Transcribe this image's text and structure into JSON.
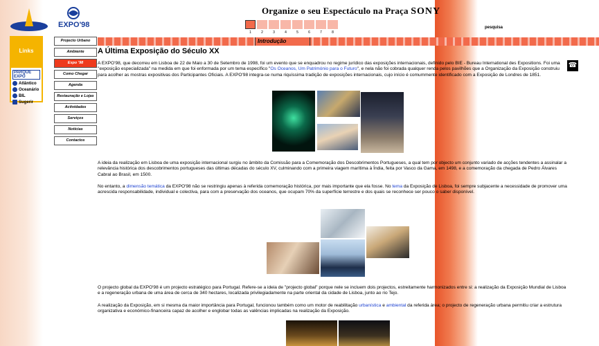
{
  "header": {
    "logo_expo_text": "EXPO'98",
    "title_prefix": "Organize o seu Espectáculo na Praça",
    "title_brand": "SONY",
    "pesquisa": "pesquisa"
  },
  "number_nav": [
    "1",
    "2",
    "3",
    "4",
    "5",
    "6",
    "7",
    "8"
  ],
  "left_panel": {
    "links_label": "Links",
    "parque_label": "PARQUE EXPO",
    "items": [
      "Atlântico",
      "Oceanário",
      "BIL",
      "Sugerir"
    ]
  },
  "menu": [
    "Projecto Urbano",
    "Ambiente",
    "Expo '98",
    "Como Chegar",
    "Agenda",
    "Restauração e Lojas",
    "Actividades",
    "Serviços",
    "Notícias",
    "Contactos"
  ],
  "section": {
    "bar_label": "Introdução",
    "title": "A Última Exposição do Século XX"
  },
  "content": {
    "p1_a": "A EXPO'98, que decorreu em Lisboa de 22 de Maio a 30 de Setembro de 1998, foi um evento que se enquadrou no regime jurídico das exposições internacionais, definido pelo BIE - Bureau International des Expositions. Foi uma \"exposição especializada\" na medida em que foi enformada por um tema específico \"",
    "p1_link": "Os Oceanos, Um Património para o Futuro",
    "p1_b": "\", e nela não foi cobrada qualquer renda pelos pavilhões que a Organização da Exposição construiu para acolher as mostras expositivas dos Participantes Oficiais. A EXPO'98 integra-se numa riquíssima tradição de exposições internacionais, cujo início é comummente identificado com a Exposição de Londres de 1851.",
    "p2": "A ideia da realização em Lisboa de uma exposição internacional surgiu no âmbito da Comissão para a Comemoração dos Descobrimentos Portugueses, a qual tem por objecto um conjunto variado de acções tendentes a assinalar a relevância histórica dos descobrimentos portugueses das últimas décadas do século XV, culminando com a primeira viagem marítima à Índia, feita por Vasco da Gama, em 1498, e a comemoração da chegada de Pedro Álvares Cabral ao Brasil, em 1500.",
    "p3_a": "No entanto, a ",
    "p3_link1": "dimensão temática",
    "p3_b": " da EXPO'98 não se restringiu apenas à referida comemoração histórica, por mais importante que ela fosse. No ",
    "p3_link2": "tema",
    "p3_c": " da Exposição de Lisboa, foi sempre subjacente a necessidade de promover uma acrescida responsabilidade, individual e colectiva, para com a preservação dos oceanos, que ocupam 70% da superfície terrestre e dos quais se reconhece ser pouco o saber disponível.",
    "p4": "O projecto global da EXPO'98 é um projecto estratégico para Portugal. Refere-se a ideia de \"projecto global\" porque nele se incluem dois projectos, estreitamente harmonizados entre si: a realização da Exposição Mundial de Lisboa e a regeneração urbana de uma área de cerca de 340 hectares, localizada privilegiadamente na parte oriental da cidade de Lisboa, junto ao rio Tejo.",
    "p5_a": "A realização da Exposição, em si mesma da maior importância para Portugal, funcionou também como um motor de reabilitação ",
    "p5_link1": "urbanística",
    "p5_b": " e ",
    "p5_link2": "ambiental",
    "p5_c": " da referida área; o projecto de regeneração urbana permitiu criar a estrutura organizativa e económico-financeira capaz de acolher e englobar todas as valências implicadas na realização da Exposição."
  },
  "colors": {
    "accent": "#f26a4b",
    "active_menu": "#ee3a1c",
    "links_box": "#f5b400",
    "link_text": "#1a3fd0"
  }
}
